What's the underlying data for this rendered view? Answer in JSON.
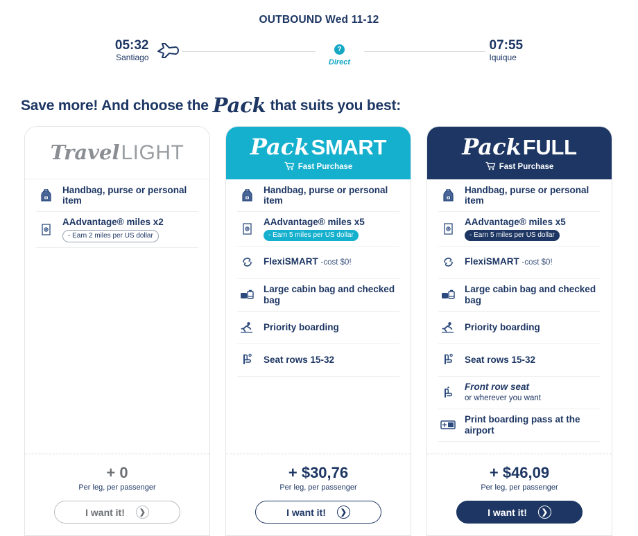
{
  "flight": {
    "heading": "OUTBOUND Wed 11-12",
    "depart_time": "05:32",
    "depart_city": "Santiago",
    "arrive_time": "07:55",
    "arrive_city": "Iquique",
    "stop_badge": "?",
    "stop_label": "Direct",
    "accent": "#14a7c4"
  },
  "promo": {
    "lead": "Save more! And choose the",
    "script": "Pack",
    "tail": "that suits you best:"
  },
  "cards": [
    {
      "id": "travel-light",
      "brand_script": "Travel",
      "brand_solid": "LIGHT",
      "theme": "light",
      "header_bg": "#ffffff",
      "fast_purchase": null,
      "features": [
        {
          "icon": "backpack-icon",
          "title": "Handbag, purse or personal item"
        },
        {
          "icon": "ticket-icon",
          "title": "AAdvantage® miles x2",
          "pill": "- Earn 2 miles per US dollar",
          "pill_style": "outline"
        }
      ],
      "price": "+ 0",
      "price_style": "gray",
      "per": "Per leg, per passenger",
      "cta_label": "I want it!",
      "cta_style": "outline-gray"
    },
    {
      "id": "pack-smart",
      "brand_script": "Pack",
      "brand_solid": "SMART",
      "theme": "smart",
      "header_bg": "#15b0cd",
      "fast_purchase": "Fast Purchase",
      "features": [
        {
          "icon": "backpack-icon",
          "title": "Handbag, purse or personal item"
        },
        {
          "icon": "ticket-icon",
          "title": "AAdvantage® miles x5",
          "pill": "- Earn 5 miles per US dollar",
          "pill_style": "teal"
        },
        {
          "icon": "refresh-icon",
          "title": "FlexiSMART",
          "suffix": "-cost $0!"
        },
        {
          "icon": "luggage-icon",
          "title": "Large cabin bag and checked bag"
        },
        {
          "icon": "boarding-icon",
          "title": "Priority boarding"
        },
        {
          "icon": "seat-icon",
          "title": "Seat rows 15-32"
        }
      ],
      "price": "+ $30,76",
      "price_style": "navy",
      "per": "Per leg, per passenger",
      "cta_label": "I want it!",
      "cta_style": "outline-navy"
    },
    {
      "id": "pack-full",
      "brand_script": "Pack",
      "brand_solid": "FULL",
      "theme": "full",
      "header_bg": "#1d3663",
      "fast_purchase": "Fast Purchase",
      "features": [
        {
          "icon": "backpack-icon",
          "title": "Handbag, purse or personal item"
        },
        {
          "icon": "ticket-icon",
          "title": "AAdvantage® miles x5",
          "pill": "- Earn 5 miles per US dollar",
          "pill_style": "navy"
        },
        {
          "icon": "refresh-icon",
          "title": "FlexiSMART",
          "suffix": "-cost $0!"
        },
        {
          "icon": "luggage-icon",
          "title": "Large cabin bag and checked bag"
        },
        {
          "icon": "boarding-icon",
          "title": "Priority boarding"
        },
        {
          "icon": "seat-icon",
          "title": "Seat rows 15-32"
        },
        {
          "icon": "front-seat-icon",
          "title": "Front row seat",
          "italic": true,
          "sub": "or wherever you want"
        },
        {
          "icon": "boarding-pass-icon",
          "title": "Print boarding pass at the airport"
        }
      ],
      "price": "+ $46,09",
      "price_style": "navy",
      "per": "Per leg, per passenger",
      "cta_label": "I want it!",
      "cta_style": "filled-navy"
    }
  ]
}
